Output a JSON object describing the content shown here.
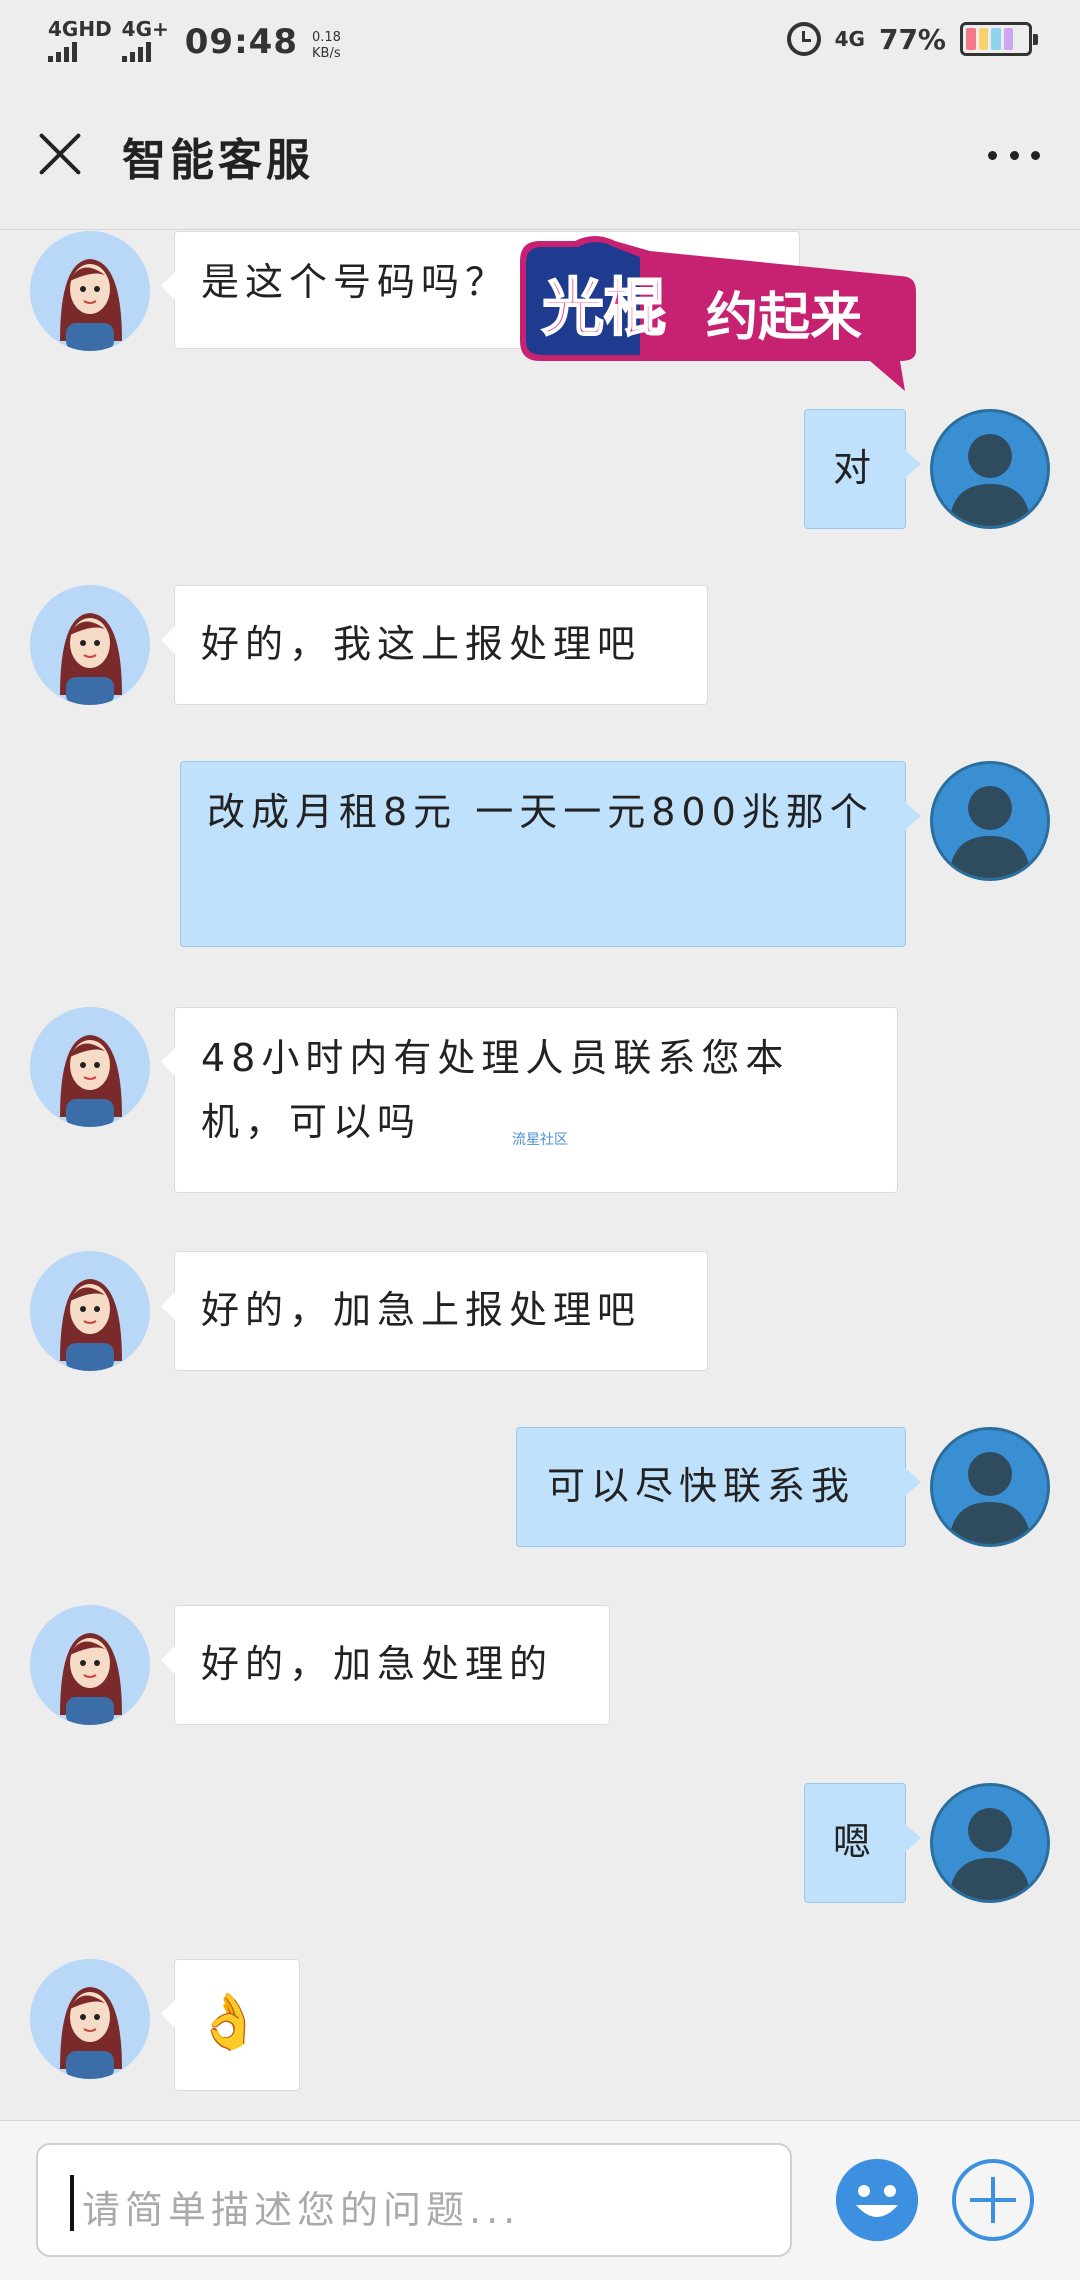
{
  "status_bar": {
    "signal1": "4GHD",
    "signal2": "4G+",
    "time": "09:48",
    "speed": "0.18",
    "speed_unit": "KB/s",
    "network": "4G",
    "battery": "77%"
  },
  "header": {
    "title": "智能客服",
    "close_icon": "close-icon",
    "more_icon": "more-icon"
  },
  "sticker_text": "光棍约起来",
  "watermark": "流星社区",
  "messages": [
    {
      "from": "agent",
      "text": "是这个号码吗？"
    },
    {
      "from": "user",
      "text": "对"
    },
    {
      "from": "agent",
      "text": "好的，我这上报处理吧"
    },
    {
      "from": "user",
      "text": "改成月租8元 一天一元800兆那个"
    },
    {
      "from": "agent",
      "text": "48小时内有处理人员联系您本机，可以吗"
    },
    {
      "from": "agent",
      "text": "好的，加急上报处理吧"
    },
    {
      "from": "user",
      "text": "可以尽快联系我"
    },
    {
      "from": "agent",
      "text": "好的，加急处理的"
    },
    {
      "from": "user",
      "text": "嗯"
    },
    {
      "from": "agent",
      "text": "👌"
    }
  ],
  "input": {
    "placeholder": "请简单描述您的问题..."
  },
  "colors": {
    "user_bubble": "#bfe1fb",
    "agent_bubble": "#ffffff",
    "accent": "#3d8fe0"
  }
}
